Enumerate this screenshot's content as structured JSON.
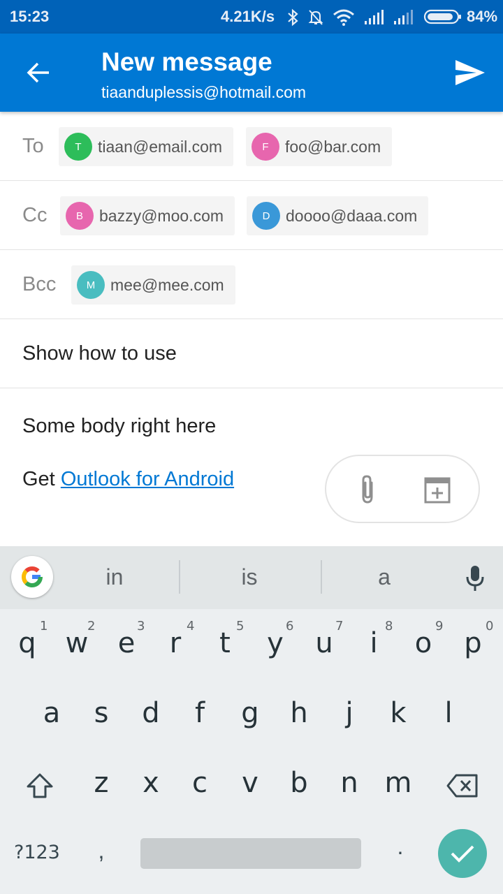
{
  "status_bar": {
    "time": "15:23",
    "net_speed": "4.21K/s",
    "battery": "84%",
    "icons": [
      "bluetooth-icon",
      "notifications-off-icon",
      "wifi-icon",
      "signal-icon",
      "signal-icon-2",
      "battery-icon"
    ]
  },
  "header": {
    "title": "New message",
    "account": "tiaanduplessis@hotmail.com",
    "back_icon": "arrow-back-icon",
    "send_icon": "send-icon",
    "bg_color": "#0078d4"
  },
  "recipients": {
    "to": {
      "label": "To",
      "chips": [
        {
          "initial": "T",
          "email": "tiaan@email.com",
          "color": "#2dbd5a"
        },
        {
          "initial": "F",
          "email": "foo@bar.com",
          "color": "#e766ae"
        }
      ]
    },
    "cc": {
      "label": "Cc",
      "chips": [
        {
          "initial": "B",
          "email": "bazzy@moo.com",
          "color": "#e766ae"
        },
        {
          "initial": "D",
          "email": "doooo@daaa.com",
          "color": "#3a98d8"
        }
      ]
    },
    "bcc": {
      "label": "Bcc",
      "chips": [
        {
          "initial": "M",
          "email": "mee@mee.com",
          "color": "#49bdc0"
        }
      ]
    }
  },
  "subject": "Show how to use",
  "body": {
    "text": "Some body right here",
    "signature_prefix": "Get ",
    "signature_link": "Outlook for Android"
  },
  "compose_actions": [
    "attachment-icon",
    "calendar-add-icon"
  ],
  "keyboard": {
    "suggestions": [
      "in",
      "is",
      "a"
    ],
    "row1": [
      {
        "key": "q",
        "hint": "1"
      },
      {
        "key": "w",
        "hint": "2"
      },
      {
        "key": "e",
        "hint": "3"
      },
      {
        "key": "r",
        "hint": "4"
      },
      {
        "key": "t",
        "hint": "5"
      },
      {
        "key": "y",
        "hint": "6"
      },
      {
        "key": "u",
        "hint": "7"
      },
      {
        "key": "i",
        "hint": "8"
      },
      {
        "key": "o",
        "hint": "9"
      },
      {
        "key": "p",
        "hint": "0"
      }
    ],
    "row2": [
      "a",
      "s",
      "d",
      "f",
      "g",
      "h",
      "j",
      "k",
      "l"
    ],
    "row3": [
      "z",
      "x",
      "c",
      "v",
      "b",
      "n",
      "m"
    ],
    "symbols_label": "?123",
    "comma": ",",
    "period": ".",
    "enter_color": "#4db6ac"
  }
}
